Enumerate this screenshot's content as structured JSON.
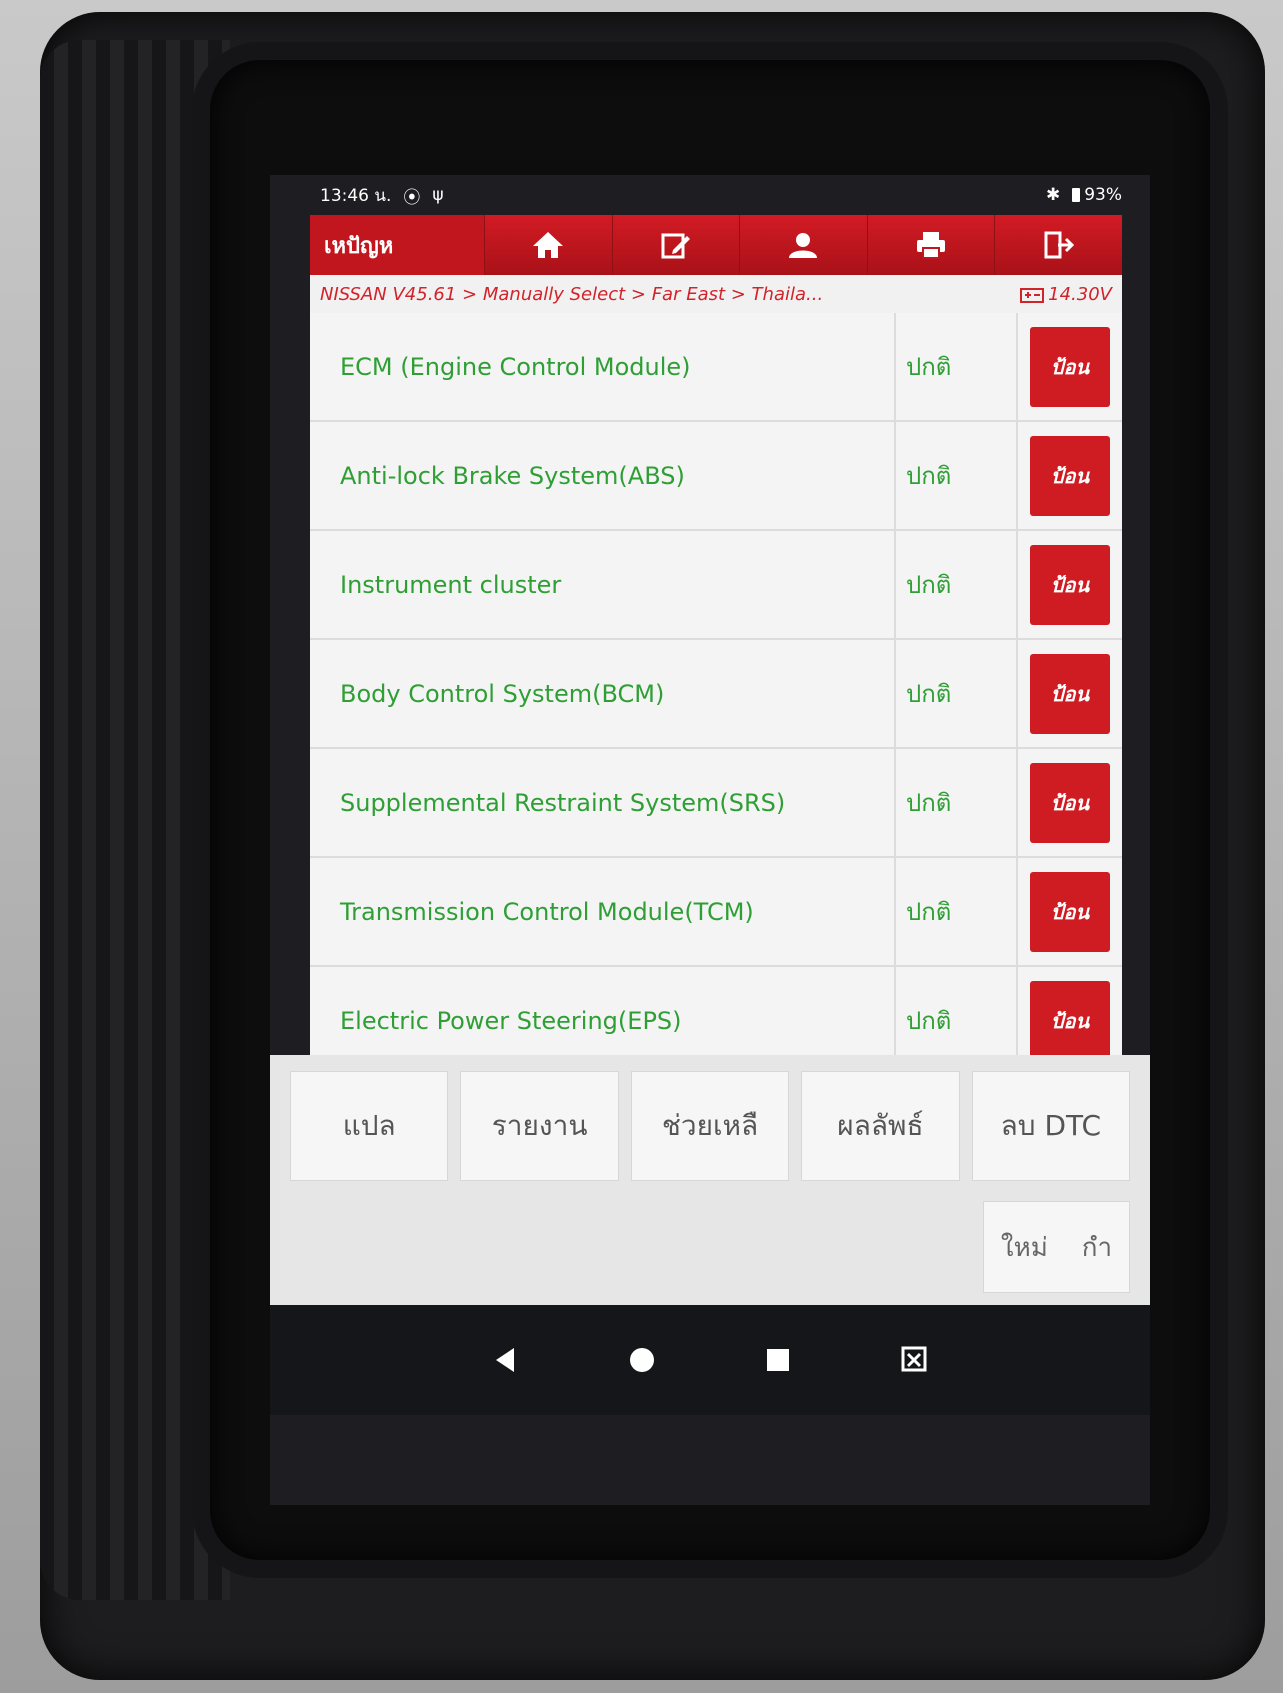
{
  "status_bar": {
    "time": "13:46 น.",
    "battery": "93%"
  },
  "toolbar": {
    "title": "เหปัญห",
    "icons": [
      "home-icon",
      "edit-icon",
      "user-icon",
      "print-icon",
      "exit-icon"
    ]
  },
  "breadcrumb": {
    "path": "NISSAN V45.61 > Manually Select > Far East > Thaila...",
    "voltage": "14.30V"
  },
  "systems": [
    {
      "name": "ECM (Engine Control Module)",
      "status": "ปกติ",
      "action": "ป้อน"
    },
    {
      "name": "Anti-lock Brake System(ABS)",
      "status": "ปกติ",
      "action": "ป้อน"
    },
    {
      "name": "Instrument cluster",
      "status": "ปกติ",
      "action": "ป้อน"
    },
    {
      "name": "Body Control System(BCM)",
      "status": "ปกติ",
      "action": "ป้อน"
    },
    {
      "name": "Supplemental Restraint System(SRS)",
      "status": "ปกติ",
      "action": "ป้อน"
    },
    {
      "name": "Transmission Control Module(TCM)",
      "status": "ปกติ",
      "action": "ป้อน"
    },
    {
      "name": "Electric Power Steering(EPS)",
      "status": "ปกติ",
      "action": "ป้อน"
    }
  ],
  "bottom_actions": [
    "แปล",
    "รายงาน",
    "ช่วยเหลื",
    "ผลลัพธ์",
    "ลบ DTC"
  ],
  "small_action": {
    "left": "ใหม่",
    "right": "กำ"
  },
  "colors": {
    "accent": "#c2161e",
    "status_text": "#2f9f35",
    "breadcrumb_text": "#d3232a"
  }
}
